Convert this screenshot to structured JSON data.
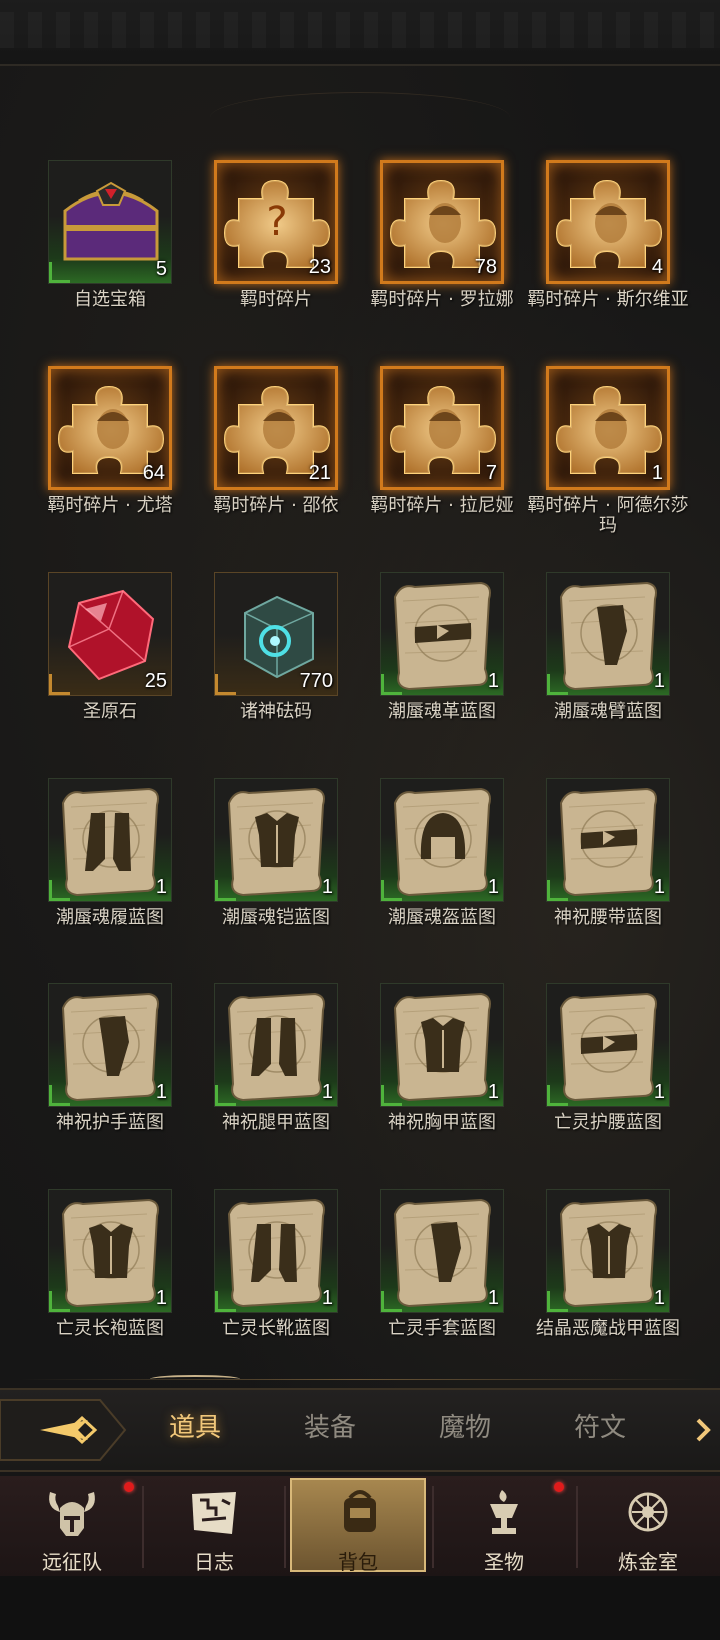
{
  "items": [
    {
      "name": "自选宝箱",
      "count": "5",
      "icon": "chest-icon",
      "style": "green"
    },
    {
      "name": "羁时碎片",
      "count": "23",
      "icon": "puzzle-question-icon",
      "style": "puzzle"
    },
    {
      "name": "羁时碎片 · 罗拉娜",
      "count": "78",
      "icon": "puzzle-portrait-icon",
      "style": "puzzle"
    },
    {
      "name": "羁时碎片 · 斯尔维亚",
      "count": "4",
      "icon": "puzzle-portrait-icon",
      "style": "puzzle"
    },
    {
      "name": "羁时碎片 · 尤塔",
      "count": "64",
      "icon": "puzzle-portrait-icon",
      "style": "puzzle"
    },
    {
      "name": "羁时碎片 · 邵依",
      "count": "21",
      "icon": "puzzle-portrait-icon",
      "style": "puzzle"
    },
    {
      "name": "羁时碎片 · 拉尼娅",
      "count": "7",
      "icon": "puzzle-portrait-icon",
      "style": "puzzle"
    },
    {
      "name": "羁时碎片 · 阿德尔莎玛",
      "count": "1",
      "icon": "puzzle-portrait-icon",
      "style": "puzzle"
    },
    {
      "name": "圣原石",
      "count": "25",
      "icon": "red-gem-icon",
      "style": "gold"
    },
    {
      "name": "诸神砝码",
      "count": "770",
      "icon": "cube-icon",
      "style": "gold"
    },
    {
      "name": "潮蜃魂革蓝图",
      "count": "1",
      "icon": "scroll-belt-icon",
      "style": "green"
    },
    {
      "name": "潮蜃魂臂蓝图",
      "count": "1",
      "icon": "scroll-arm-icon",
      "style": "green"
    },
    {
      "name": "潮蜃魂履蓝图",
      "count": "1",
      "icon": "scroll-boots-icon",
      "style": "green"
    },
    {
      "name": "潮蜃魂铠蓝图",
      "count": "1",
      "icon": "scroll-armor-icon",
      "style": "green"
    },
    {
      "name": "潮蜃魂盔蓝图",
      "count": "1",
      "icon": "scroll-helmet-icon",
      "style": "green"
    },
    {
      "name": "神祝腰带蓝图",
      "count": "1",
      "icon": "scroll-belt-icon",
      "style": "green"
    },
    {
      "name": "神祝护手蓝图",
      "count": "1",
      "icon": "scroll-arm-icon",
      "style": "green"
    },
    {
      "name": "神祝腿甲蓝图",
      "count": "1",
      "icon": "scroll-boots-icon",
      "style": "green"
    },
    {
      "name": "神祝胸甲蓝图",
      "count": "1",
      "icon": "scroll-armor-icon",
      "style": "green"
    },
    {
      "name": "亡灵护腰蓝图",
      "count": "1",
      "icon": "scroll-belt-icon",
      "style": "green"
    },
    {
      "name": "亡灵长袍蓝图",
      "count": "1",
      "icon": "scroll-armor-icon",
      "style": "green"
    },
    {
      "name": "亡灵长靴蓝图",
      "count": "1",
      "icon": "scroll-boots-icon",
      "style": "green"
    },
    {
      "name": "亡灵手套蓝图",
      "count": "1",
      "icon": "scroll-arm-icon",
      "style": "green"
    },
    {
      "name": "结晶恶魔战甲蓝图",
      "count": "1",
      "icon": "scroll-armor-icon",
      "style": "green"
    }
  ],
  "tabs": [
    {
      "label": "道具",
      "active": true
    },
    {
      "label": "装备",
      "active": false
    },
    {
      "label": "魔物",
      "active": false
    },
    {
      "label": "符文",
      "active": false
    }
  ],
  "nav": [
    {
      "label": "远征队",
      "icon": "horned-helmet-icon",
      "notify": true
    },
    {
      "label": "日志",
      "icon": "map-scroll-icon",
      "notify": false
    },
    {
      "label": "背包",
      "icon": "backpack-icon",
      "notify": false,
      "active": true
    },
    {
      "label": "圣物",
      "icon": "chalice-icon",
      "notify": true
    },
    {
      "label": "炼金室",
      "icon": "alchemy-icon",
      "notify": false
    }
  ],
  "colors": {
    "accent": "#f1c77a",
    "puzzle_border": "#d17a1c",
    "rarity_green": "#4fb33c",
    "notify": "#e01b1b"
  }
}
